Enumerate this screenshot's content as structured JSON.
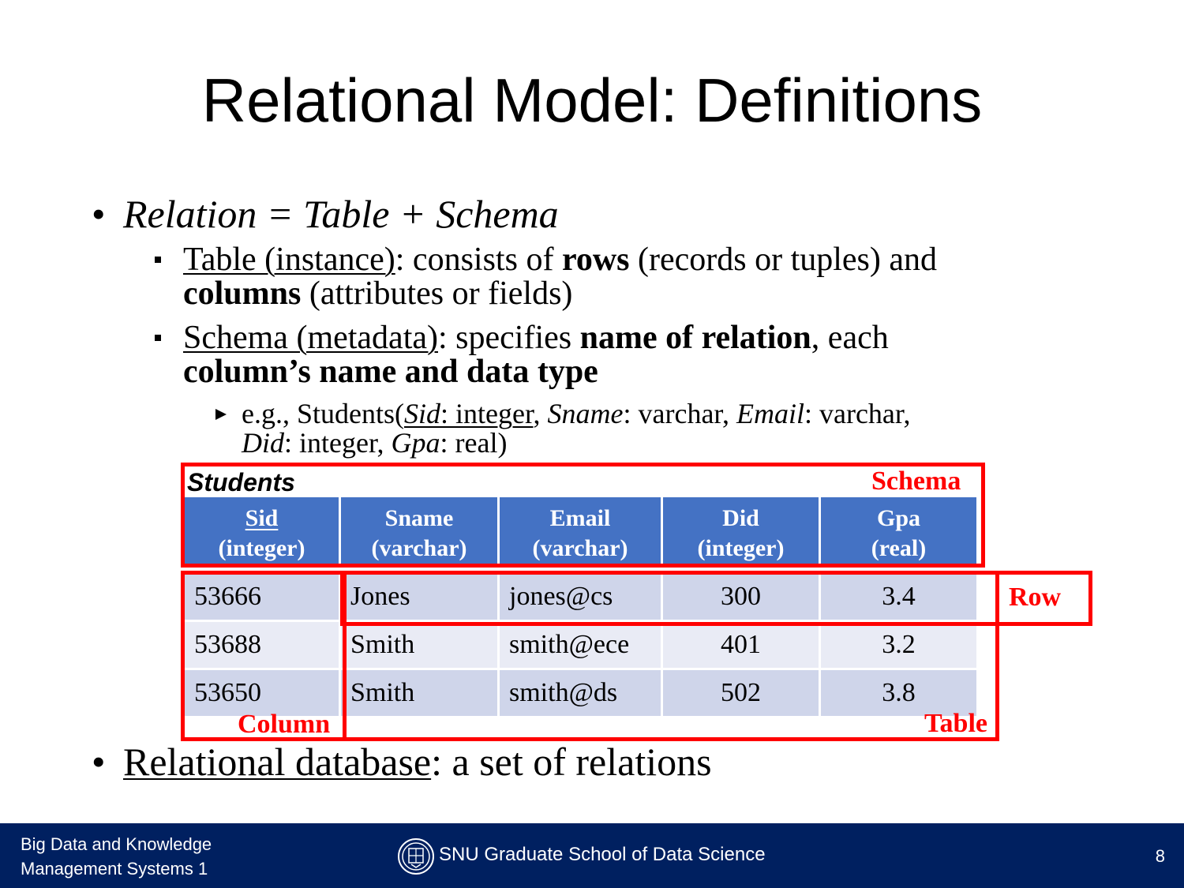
{
  "title": "Relational Model: Definitions",
  "bullets": {
    "b1": "Relation = Table + Schema",
    "b1a": {
      "term": "Table (instance)",
      "t1": ": consists of ",
      "t2": "rows",
      "t3": " (records or tuples) and",
      "t4": "columns",
      "t5": " (attributes or fields)"
    },
    "b1b": {
      "term": "Schema (metadata)",
      "t1": ": specifies ",
      "t2": "name of relation",
      "t3": ", each",
      "t4": "column’s name and data type"
    },
    "b1b1": {
      "pre": "e.g., Students(",
      "sid": "Sid",
      "sid_type": ": integer",
      "sep1": ", ",
      "sname": "Sname",
      "sname_type": ": varchar, ",
      "email": "Email",
      "email_type": ": varchar,",
      "did": "Did",
      "did_type": ": integer, ",
      "gpa": "Gpa",
      "gpa_type": ": real)"
    },
    "b2": {
      "term": "Relational database",
      "rest": ": a set of relations"
    }
  },
  "table": {
    "name": "Students",
    "headers": [
      {
        "name": "Sid",
        "type": "(integer)"
      },
      {
        "name": "Sname",
        "type": "(varchar)"
      },
      {
        "name": "Email",
        "type": "(varchar)"
      },
      {
        "name": "Did",
        "type": "(integer)"
      },
      {
        "name": "Gpa",
        "type": "(real)"
      }
    ],
    "rows": [
      [
        "53666",
        "Jones",
        "jones@cs",
        "300",
        "3.4"
      ],
      [
        "53688",
        "Smith",
        "smith@ece",
        "401",
        "3.2"
      ],
      [
        "53650",
        "Smith",
        "smith@ds",
        "502",
        "3.8"
      ]
    ]
  },
  "annotations": {
    "schema": "Schema",
    "row": "Row",
    "column": "Column",
    "table": "Table"
  },
  "colors": {
    "header_blue": "#4472c4",
    "annotation_red": "#ff0000",
    "footer_navy": "#002060"
  },
  "footer": {
    "course_line1": "Big Data and Knowledge",
    "course_line2": "Management Systems 1",
    "school": "SNU Graduate School of Data Science",
    "page": "8",
    "logo_icon": "snu-seal-icon"
  }
}
